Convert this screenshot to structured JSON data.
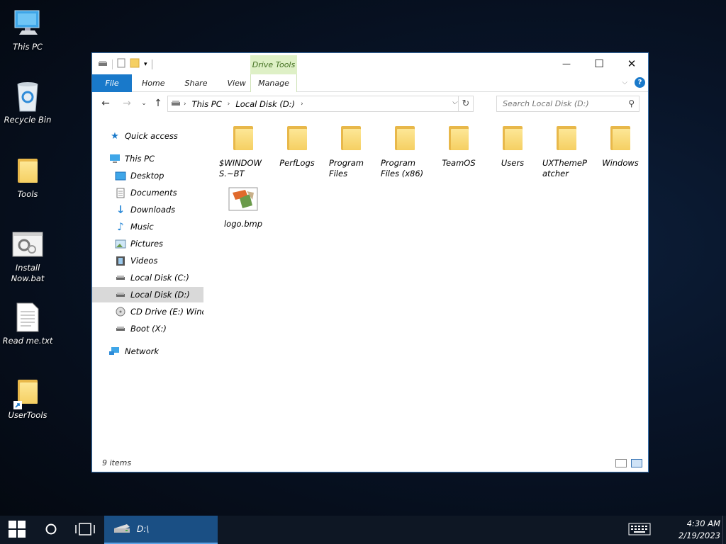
{
  "desktop": {
    "icons": [
      {
        "label": "This PC"
      },
      {
        "label": "Recycle Bin"
      },
      {
        "label": "Tools"
      },
      {
        "label": "Install Now.bat"
      },
      {
        "label": "Read me.txt"
      },
      {
        "label": "UserTools"
      }
    ]
  },
  "window": {
    "context_tab": "Drive Tools",
    "tabs": {
      "file": "File",
      "home": "Home",
      "share": "Share",
      "view": "View",
      "manage": "Manage"
    },
    "controls": {
      "minimize": "—",
      "maximize": "☐",
      "close": "✕"
    },
    "help": "?",
    "address": {
      "segments": [
        "This PC",
        "Local Disk (D:)"
      ]
    },
    "search": {
      "placeholder": "Search Local Disk (D:)"
    },
    "nav": {
      "quick_access": "Quick access",
      "this_pc": "This PC",
      "desktop": "Desktop",
      "documents": "Documents",
      "downloads": "Downloads",
      "music": "Music",
      "pictures": "Pictures",
      "videos": "Videos",
      "local_c": "Local Disk (C:)",
      "local_d": "Local Disk (D:)",
      "cd_drive": "CD Drive (E:) Windo",
      "boot": "Boot (X:)",
      "network": "Network"
    },
    "files": [
      {
        "name": "$WINDOWS.~BT",
        "type": "folder"
      },
      {
        "name": "PerfLogs",
        "type": "folder"
      },
      {
        "name": "Program Files",
        "type": "folder"
      },
      {
        "name": "Program Files (x86)",
        "type": "folder"
      },
      {
        "name": "TeamOS",
        "type": "folder"
      },
      {
        "name": "Users",
        "type": "folder"
      },
      {
        "name": "UXThemePatcher",
        "type": "folder"
      },
      {
        "name": "Windows",
        "type": "folder"
      },
      {
        "name": "logo.bmp",
        "type": "bitmap-image"
      }
    ],
    "status": "9 items"
  },
  "taskbar": {
    "app_label": "D:\\",
    "time": "4:30 AM",
    "date": "2/19/2023"
  },
  "colors": {
    "accent": "#1979ca",
    "drive_tools_bg": "#def0c6",
    "taskbar": "#0e1724",
    "folder": "#f5cf62"
  }
}
